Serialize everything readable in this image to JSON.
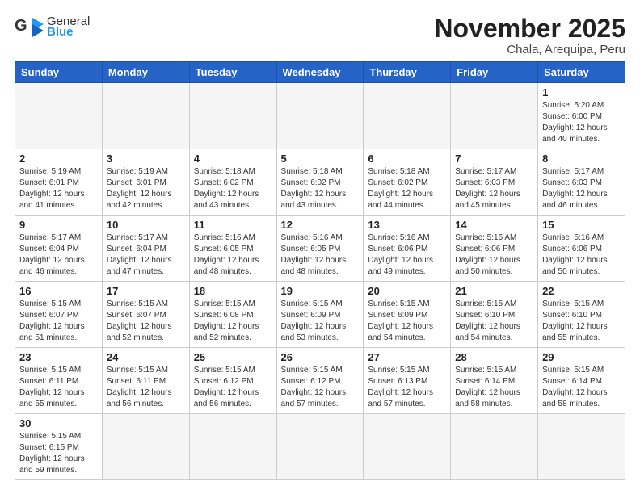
{
  "logo": {
    "text_general": "General",
    "text_blue": "Blue"
  },
  "header": {
    "title": "November 2025",
    "subtitle": "Chala, Arequipa, Peru"
  },
  "weekdays": [
    "Sunday",
    "Monday",
    "Tuesday",
    "Wednesday",
    "Thursday",
    "Friday",
    "Saturday"
  ],
  "weeks": [
    [
      {
        "day": "",
        "empty": true
      },
      {
        "day": "",
        "empty": true
      },
      {
        "day": "",
        "empty": true
      },
      {
        "day": "",
        "empty": true
      },
      {
        "day": "",
        "empty": true
      },
      {
        "day": "",
        "empty": true
      },
      {
        "day": "1",
        "sunrise": "5:20 AM",
        "sunset": "6:00 PM",
        "daylight": "12 hours and 40 minutes."
      }
    ],
    [
      {
        "day": "2",
        "sunrise": "5:19 AM",
        "sunset": "6:01 PM",
        "daylight": "12 hours and 41 minutes."
      },
      {
        "day": "3",
        "sunrise": "5:19 AM",
        "sunset": "6:01 PM",
        "daylight": "12 hours and 42 minutes."
      },
      {
        "day": "4",
        "sunrise": "5:18 AM",
        "sunset": "6:02 PM",
        "daylight": "12 hours and 43 minutes."
      },
      {
        "day": "5",
        "sunrise": "5:18 AM",
        "sunset": "6:02 PM",
        "daylight": "12 hours and 43 minutes."
      },
      {
        "day": "6",
        "sunrise": "5:18 AM",
        "sunset": "6:02 PM",
        "daylight": "12 hours and 44 minutes."
      },
      {
        "day": "7",
        "sunrise": "5:17 AM",
        "sunset": "6:03 PM",
        "daylight": "12 hours and 45 minutes."
      },
      {
        "day": "8",
        "sunrise": "5:17 AM",
        "sunset": "6:03 PM",
        "daylight": "12 hours and 46 minutes."
      }
    ],
    [
      {
        "day": "9",
        "sunrise": "5:17 AM",
        "sunset": "6:04 PM",
        "daylight": "12 hours and 46 minutes."
      },
      {
        "day": "10",
        "sunrise": "5:17 AM",
        "sunset": "6:04 PM",
        "daylight": "12 hours and 47 minutes."
      },
      {
        "day": "11",
        "sunrise": "5:16 AM",
        "sunset": "6:05 PM",
        "daylight": "12 hours and 48 minutes."
      },
      {
        "day": "12",
        "sunrise": "5:16 AM",
        "sunset": "6:05 PM",
        "daylight": "12 hours and 48 minutes."
      },
      {
        "day": "13",
        "sunrise": "5:16 AM",
        "sunset": "6:06 PM",
        "daylight": "12 hours and 49 minutes."
      },
      {
        "day": "14",
        "sunrise": "5:16 AM",
        "sunset": "6:06 PM",
        "daylight": "12 hours and 50 minutes."
      },
      {
        "day": "15",
        "sunrise": "5:16 AM",
        "sunset": "6:06 PM",
        "daylight": "12 hours and 50 minutes."
      }
    ],
    [
      {
        "day": "16",
        "sunrise": "5:15 AM",
        "sunset": "6:07 PM",
        "daylight": "12 hours and 51 minutes."
      },
      {
        "day": "17",
        "sunrise": "5:15 AM",
        "sunset": "6:07 PM",
        "daylight": "12 hours and 52 minutes."
      },
      {
        "day": "18",
        "sunrise": "5:15 AM",
        "sunset": "6:08 PM",
        "daylight": "12 hours and 52 minutes."
      },
      {
        "day": "19",
        "sunrise": "5:15 AM",
        "sunset": "6:09 PM",
        "daylight": "12 hours and 53 minutes."
      },
      {
        "day": "20",
        "sunrise": "5:15 AM",
        "sunset": "6:09 PM",
        "daylight": "12 hours and 54 minutes."
      },
      {
        "day": "21",
        "sunrise": "5:15 AM",
        "sunset": "6:10 PM",
        "daylight": "12 hours and 54 minutes."
      },
      {
        "day": "22",
        "sunrise": "5:15 AM",
        "sunset": "6:10 PM",
        "daylight": "12 hours and 55 minutes."
      }
    ],
    [
      {
        "day": "23",
        "sunrise": "5:15 AM",
        "sunset": "6:11 PM",
        "daylight": "12 hours and 55 minutes."
      },
      {
        "day": "24",
        "sunrise": "5:15 AM",
        "sunset": "6:11 PM",
        "daylight": "12 hours and 56 minutes."
      },
      {
        "day": "25",
        "sunrise": "5:15 AM",
        "sunset": "6:12 PM",
        "daylight": "12 hours and 56 minutes."
      },
      {
        "day": "26",
        "sunrise": "5:15 AM",
        "sunset": "6:12 PM",
        "daylight": "12 hours and 57 minutes."
      },
      {
        "day": "27",
        "sunrise": "5:15 AM",
        "sunset": "6:13 PM",
        "daylight": "12 hours and 57 minutes."
      },
      {
        "day": "28",
        "sunrise": "5:15 AM",
        "sunset": "6:14 PM",
        "daylight": "12 hours and 58 minutes."
      },
      {
        "day": "29",
        "sunrise": "5:15 AM",
        "sunset": "6:14 PM",
        "daylight": "12 hours and 58 minutes."
      }
    ],
    [
      {
        "day": "30",
        "sunrise": "5:15 AM",
        "sunset": "6:15 PM",
        "daylight": "12 hours and 59 minutes."
      },
      {
        "day": "",
        "empty": true
      },
      {
        "day": "",
        "empty": true
      },
      {
        "day": "",
        "empty": true
      },
      {
        "day": "",
        "empty": true
      },
      {
        "day": "",
        "empty": true
      },
      {
        "day": "",
        "empty": true
      }
    ]
  ]
}
